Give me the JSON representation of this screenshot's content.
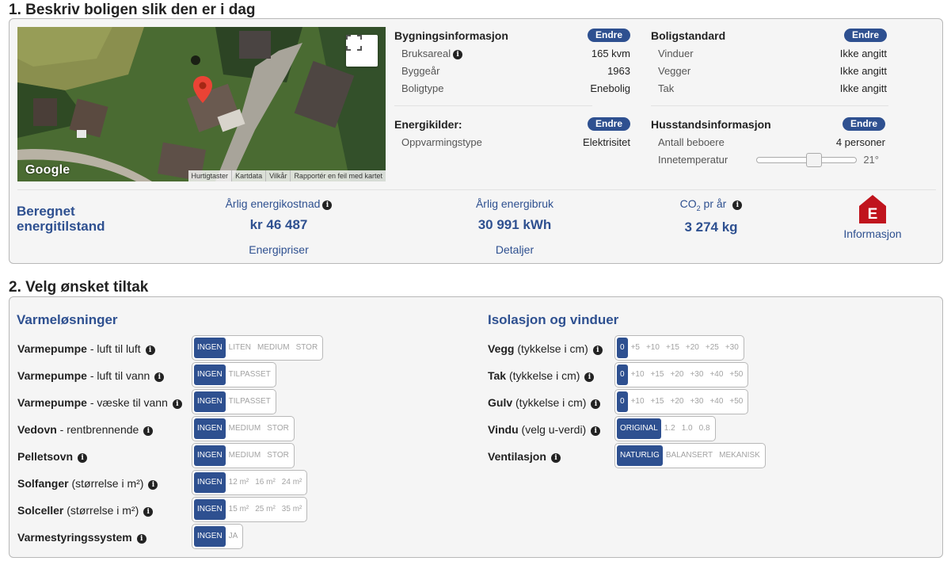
{
  "section1": {
    "heading": "1. Beskriv boligen slik den er i dag",
    "map": {
      "brand": "Google",
      "attribution": [
        "Hurtigtaster",
        "Kartdata",
        "Vilkår",
        "Rapportér en feil med kartet"
      ]
    },
    "building": {
      "title": "Bygningsinformasjon",
      "edit": "Endre",
      "rows": [
        {
          "label": "Bruksareal",
          "value": "165 kvm"
        },
        {
          "label": "Byggeår",
          "value": "1963"
        },
        {
          "label": "Boligtype",
          "value": "Enebolig"
        }
      ]
    },
    "standard": {
      "title": "Boligstandard",
      "edit": "Endre",
      "rows": [
        {
          "label": "Vinduer",
          "value": "Ikke angitt"
        },
        {
          "label": "Vegger",
          "value": "Ikke angitt"
        },
        {
          "label": "Tak",
          "value": "Ikke angitt"
        }
      ]
    },
    "energy_sources": {
      "title": "Energikilder:",
      "edit": "Endre",
      "rows": [
        {
          "label": "Oppvarmingstype",
          "value": "Elektrisitet"
        }
      ]
    },
    "household": {
      "title": "Husstandsinformasjon",
      "edit": "Endre",
      "residents_label": "Antall beboere",
      "residents_value": "4 personer",
      "temp_label": "Innetemperatur",
      "temp_value": "21°"
    },
    "summary": {
      "title_line1": "Beregnet",
      "title_line2": "energitilstand",
      "cost_label": "Årlig energikostnad",
      "cost_value": "kr 46 487",
      "cost_link": "Energipriser",
      "use_label": "Årlig energibruk",
      "use_value": "30 991  kWh",
      "use_link": "Detaljer",
      "co2_prefix": "CO",
      "co2_sub": "2",
      "co2_suffix": " pr år",
      "co2_value": "3 274  kg",
      "rating": "E",
      "rating_link": "Informasjon",
      "rating_color": "#c0141d"
    }
  },
  "section2": {
    "heading": "2. Velg ønsket tiltak",
    "heating": {
      "title": "Varmeløsninger",
      "items": [
        {
          "bold": "Varmepumpe",
          "rest": " - luft til luft",
          "options": [
            "INGEN",
            "LITEN",
            "MEDIUM",
            "STOR"
          ]
        },
        {
          "bold": "Varmepumpe",
          "rest": " - luft til vann",
          "options": [
            "INGEN",
            "TILPASSET"
          ]
        },
        {
          "bold": "Varmepumpe",
          "rest": " - væske til vann",
          "options": [
            "INGEN",
            "TILPASSET"
          ]
        },
        {
          "bold": "Vedovn",
          "rest": " - rentbrennende",
          "options": [
            "INGEN",
            "MEDIUM",
            "STOR"
          ]
        },
        {
          "bold": "Pelletsovn",
          "rest": "",
          "options": [
            "INGEN",
            "MEDIUM",
            "STOR"
          ]
        },
        {
          "bold": "Solfanger",
          "rest": " (størrelse i m²)",
          "options": [
            "INGEN",
            "12 m²",
            "16 m²",
            "24 m²"
          ]
        },
        {
          "bold": "Solceller",
          "rest": " (størrelse i m²)",
          "options": [
            "INGEN",
            "15 m²",
            "25 m²",
            "35 m²"
          ]
        },
        {
          "bold": "Varmestyringssystem",
          "rest": "",
          "options": [
            "INGEN",
            "JA"
          ]
        }
      ]
    },
    "insulation": {
      "title": "Isolasjon og vinduer",
      "items": [
        {
          "bold": "Vegg",
          "rest": " (tykkelse i cm)",
          "options": [
            "0",
            "+5",
            "+10",
            "+15",
            "+20",
            "+25",
            "+30"
          ]
        },
        {
          "bold": "Tak",
          "rest": " (tykkelse i cm)",
          "options": [
            "0",
            "+10",
            "+15",
            "+20",
            "+30",
            "+40",
            "+50"
          ]
        },
        {
          "bold": "Gulv",
          "rest": " (tykkelse i cm)",
          "options": [
            "0",
            "+10",
            "+15",
            "+20",
            "+30",
            "+40",
            "+50"
          ]
        },
        {
          "bold": "Vindu",
          "rest": " (velg u-verdi)",
          "options": [
            "ORIGINAL",
            "1.2",
            "1.0",
            "0.8"
          ]
        },
        {
          "bold": "Ventilasjon",
          "rest": "",
          "options": [
            "NATURLIG",
            "BALANSERT",
            "MEKANISK"
          ]
        }
      ]
    }
  },
  "colors": {
    "accent": "#2e5090",
    "panel_bg": "#f5f5f5"
  }
}
